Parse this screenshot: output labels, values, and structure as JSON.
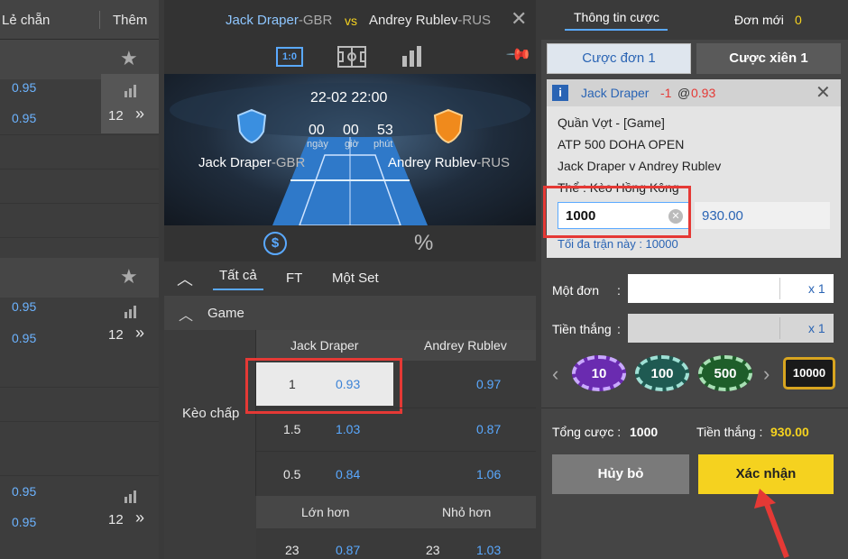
{
  "left": {
    "header_odds": "Lẻ chẵn",
    "header_more": "Thêm",
    "groups": [
      {
        "odds": [
          "0.95",
          "0.95"
        ],
        "count": "12"
      },
      {
        "odds": [
          "0.95",
          "0.95"
        ],
        "count": "12"
      },
      {
        "odds": [
          "0.95",
          "0.95"
        ],
        "count": "12"
      }
    ]
  },
  "match": {
    "player1": "Jack Draper",
    "player1_country": "-GBR",
    "vs": "vs",
    "player2": "Andrey Rublev",
    "player2_country": "-RUS",
    "datetime": "22-02 22:00",
    "countdown": {
      "days": "00",
      "hours": "00",
      "minutes": "53"
    },
    "countdown_labels": {
      "days": "ngày",
      "hours": "giờ",
      "minutes": "phút"
    },
    "score_icon_label": "1:0",
    "percent_icon": "%"
  },
  "tabs": [
    "Tất cả",
    "FT",
    "Một Set"
  ],
  "section": {
    "title": "Game",
    "row_label": "Kèo chấp",
    "col1": "Jack Draper",
    "col2": "Andrey Rublev",
    "handicap_rows": [
      {
        "line1": "1",
        "odd1": "0.93",
        "line2": "",
        "odd2": "0.97"
      },
      {
        "line1": "1.5",
        "odd1": "1.03",
        "line2": "",
        "odd2": "0.87"
      },
      {
        "line1": "0.5",
        "odd1": "0.84",
        "line2": "",
        "odd2": "1.06"
      }
    ],
    "over_label": "Lớn hơn",
    "under_label": "Nhỏ hơn",
    "ou_row": {
      "line1": "23",
      "odd1": "0.87",
      "line2": "23",
      "odd2": "1.03"
    }
  },
  "betslip": {
    "tab_info": "Thông tin cược",
    "tab_new": "Đơn mới",
    "new_count": "0",
    "single_btn": "Cược đơn 1",
    "parlay_btn": "Cược xiên 1",
    "pick_team": "Jack Draper",
    "pick_line": "-1",
    "pick_at": "@",
    "pick_odds": "0.93",
    "sport_line": "Quần Vợt - [Game]",
    "league": "ATP 500 DOHA OPEN",
    "event": "Jack Draper v Andrey Rublev",
    "market": "Thể : Kèo Hồng Kông",
    "stake_value": "1000",
    "win_value": "930.00",
    "max_text": "Tối đa trận này : 10000",
    "single_label": "Một đơn",
    "single_colon": ":",
    "win_label": "Tiền thắng",
    "win_colon": ":",
    "multiplier": "x 1",
    "chips": [
      "10",
      "100",
      "500",
      "10000"
    ],
    "total_label": "Tổng cược :",
    "total_value": "1000",
    "total_win_label": "Tiền thắng :",
    "total_win_value": "930.00",
    "cancel": "Hủy bỏ",
    "confirm": "Xác nhận"
  },
  "colors": {
    "accent_yellow": "#f5d21f",
    "odds_blue": "#5aa9ff",
    "highlight_red": "#e53935"
  }
}
